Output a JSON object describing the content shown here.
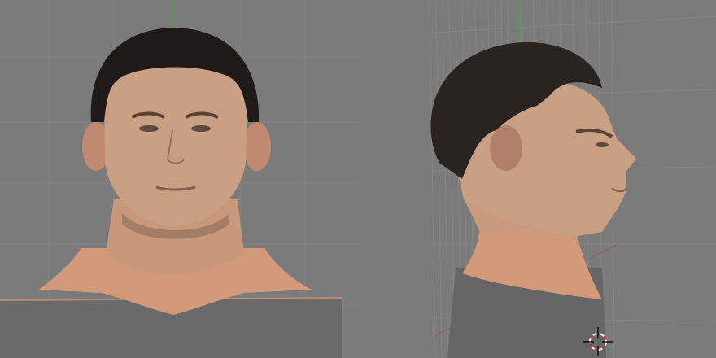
{
  "viewports": [
    {
      "id": "front",
      "view": "front-orthographic",
      "content": "3d-head-mesh-textured",
      "grid_visible": true
    },
    {
      "id": "side",
      "view": "side-perspective",
      "content": "3d-head-mesh-textured",
      "grid_visible": true,
      "cursor_icon": "3d-cursor-crosshair-icon"
    }
  ],
  "colors": {
    "background": "#7b7b7b",
    "grid_line": "#858585",
    "axis_green": "#4e9a4e",
    "axis_red": "#9a5a5a",
    "skin": "#c9a083",
    "skin_neck": "#d29a78",
    "hair": "#1f1a17",
    "shirt": "#5f5f5f",
    "cursor_red": "#c83232",
    "cursor_white": "#ffffff"
  }
}
